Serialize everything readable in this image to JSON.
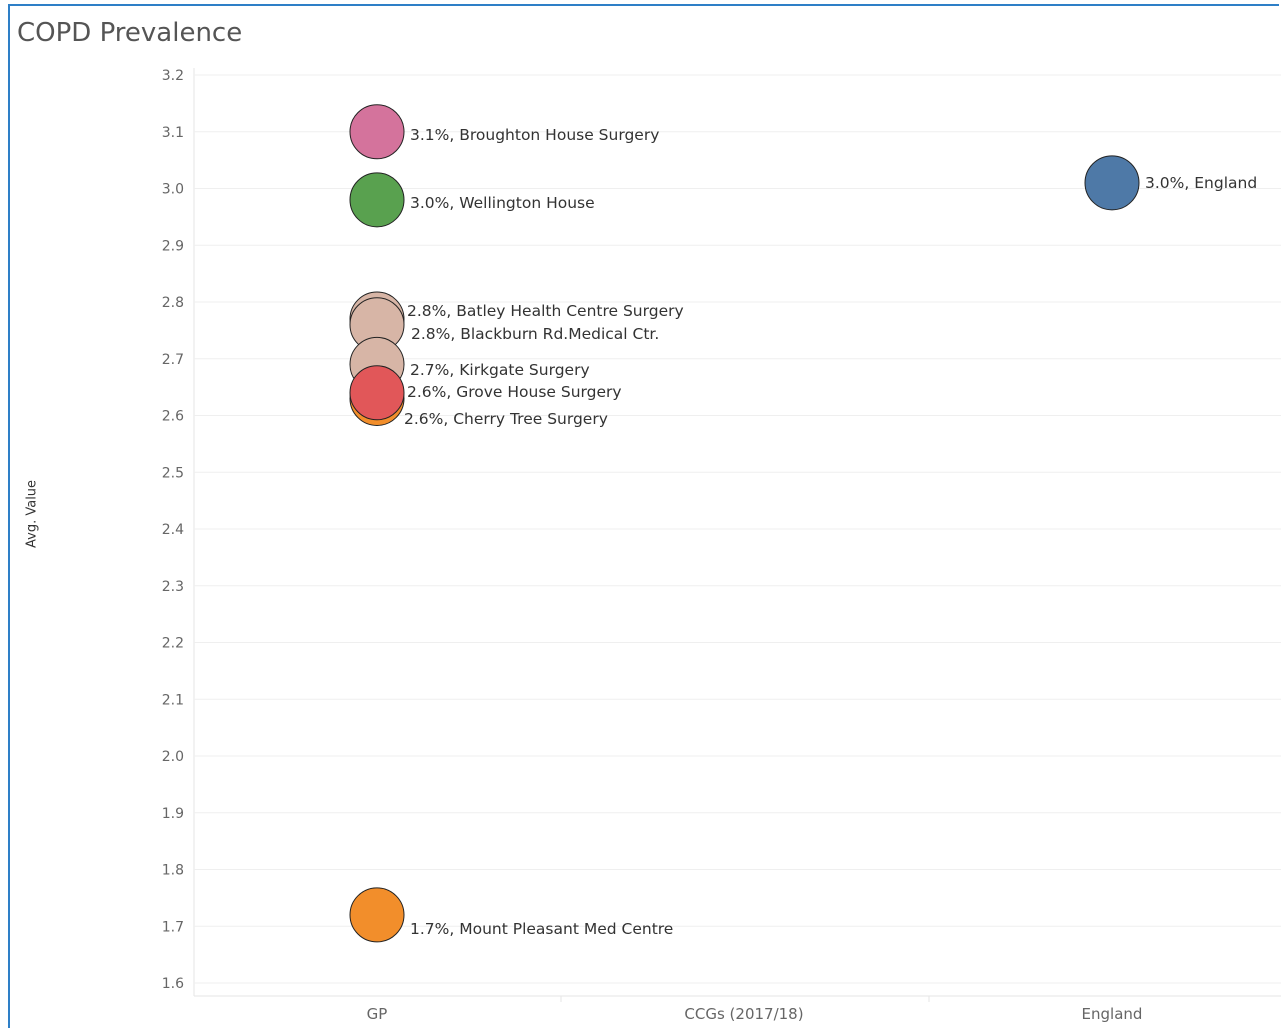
{
  "page": {
    "title": "COPD Prevalence"
  },
  "chart_data": {
    "type": "scatter",
    "title": "COPD Prevalence",
    "xlabel": "",
    "ylabel": "Avg. Value",
    "ylim": [
      1.58,
      3.22
    ],
    "y_ticks": [
      3.2,
      3.1,
      3.0,
      2.9,
      2.8,
      2.7,
      2.6,
      2.5,
      2.4,
      2.3,
      2.2,
      2.1,
      2.0,
      1.9,
      1.8,
      1.7,
      1.6
    ],
    "y_tick_labels": [
      "3.2",
      "3.1",
      "3.0",
      "2.9",
      "2.8",
      "2.7",
      "2.6",
      "2.5",
      "2.4",
      "2.3",
      "2.2",
      "2.1",
      "2.0",
      "1.9",
      "1.8",
      "1.7",
      "1.6"
    ],
    "categories": [
      "GP",
      "CCGs (2017/18)",
      "England"
    ],
    "grid": true,
    "points": [
      {
        "category": "GP",
        "y": 3.1,
        "label": "3.1%, Broughton House Surgery",
        "color": "#d4739c"
      },
      {
        "category": "GP",
        "y": 2.98,
        "label": "3.0%, Wellington House",
        "color": "#59a14f"
      },
      {
        "category": "GP",
        "y": 2.77,
        "label": "2.8%, Batley Health Centre Surgery",
        "color": "#d7b5a6"
      },
      {
        "category": "GP",
        "y": 2.76,
        "label": "2.8%, Blackburn Rd.Medical Ctr.",
        "color": "#d7b5a6"
      },
      {
        "category": "GP",
        "y": 2.69,
        "label": "2.7%, Kirkgate Surgery",
        "color": "#d7b5a6"
      },
      {
        "category": "GP",
        "y": 2.63,
        "label": "2.6%, Cherry Tree Surgery",
        "color": "#f28e2b"
      },
      {
        "category": "GP",
        "y": 2.64,
        "label": "2.6%, Grove House Surgery",
        "color": "#e15759"
      },
      {
        "category": "GP",
        "y": 1.72,
        "label": "1.7%, Mount Pleasant Med Centre",
        "color": "#f28e2b"
      },
      {
        "category": "England",
        "y": 3.01,
        "label": "3.0%, England",
        "color": "#4e79a7"
      }
    ]
  }
}
